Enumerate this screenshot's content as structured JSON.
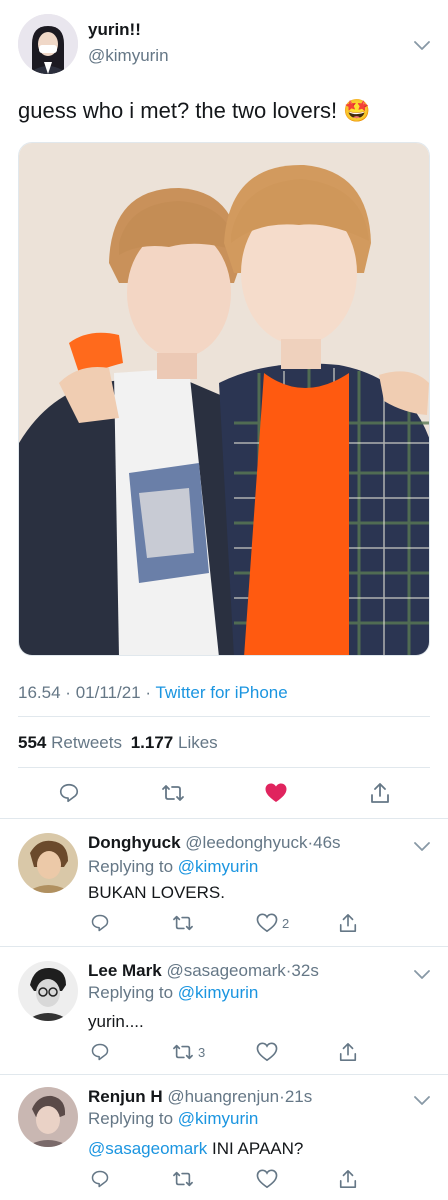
{
  "tweet": {
    "author_name": "yurin!!",
    "author_handle": "@kimyurin",
    "text": "guess who i met? the two lovers!",
    "emoji": "🤩",
    "time": "16.54",
    "date": "01/11/21",
    "source": "Twitter for iPhone",
    "retweets_count": "554",
    "retweets_label": "Retweets",
    "likes_count": "1.177",
    "likes_label": "Likes"
  },
  "replies": [
    {
      "name": "Donghyuck",
      "handle": "@leedonghyuck",
      "time": "46s",
      "replying_prefix": "Replying to",
      "replying_to": "@kimyurin",
      "mention": "",
      "text": "BUKAN LOVERS.",
      "retweet_count": "",
      "like_count": "2"
    },
    {
      "name": "Lee Mark",
      "handle": "@sasageomark",
      "time": "32s",
      "replying_prefix": "Replying to",
      "replying_to": "@kimyurin",
      "mention": "",
      "text": "yurin....",
      "retweet_count": "3",
      "like_count": ""
    },
    {
      "name": "Renjun H",
      "handle": "@huangrenjun",
      "time": "21s",
      "replying_prefix": "Replying to",
      "replying_to": "@kimyurin",
      "mention": "@sasageomark",
      "text": "INI APAAN?",
      "retweet_count": "",
      "like_count": ""
    }
  ],
  "icons": {
    "reply": "reply-icon",
    "retweet": "retweet-icon",
    "like": "heart-icon",
    "share": "share-icon",
    "menu": "chevron-down-icon"
  },
  "colors": {
    "link": "#1b95e0",
    "secondary": "#657786",
    "like_active": "#e0245e",
    "divider": "#e1e8ed"
  }
}
